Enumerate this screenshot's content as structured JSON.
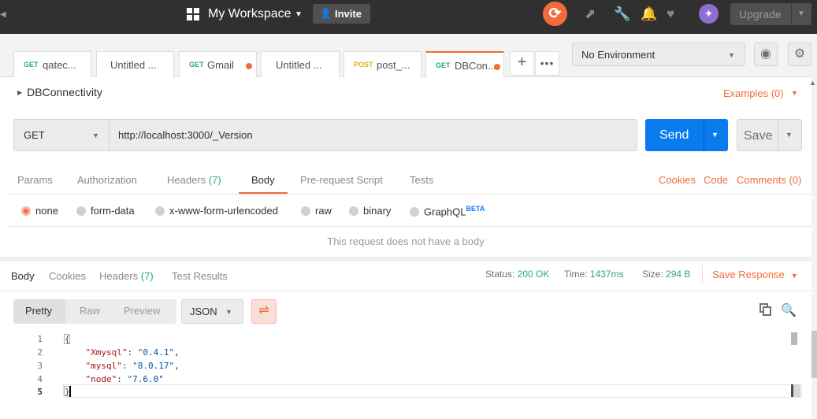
{
  "topbar": {
    "workspace_label": "My Workspace",
    "invite_label": "Invite",
    "upgrade_label": "Upgrade"
  },
  "tabs": [
    {
      "method": "GET",
      "name": "qatec...",
      "dot": false
    },
    {
      "method": "",
      "name": "Untitled ...",
      "dot": false
    },
    {
      "method": "GET",
      "name": "Gmail",
      "dot": true
    },
    {
      "method": "",
      "name": "Untitled ...",
      "dot": false
    },
    {
      "method": "POST",
      "name": "post_...",
      "dot": false
    },
    {
      "method": "GET",
      "name": "DBCon...",
      "dot": true
    }
  ],
  "environment": {
    "selected": "No Environment"
  },
  "request": {
    "name": "DBConnectivity",
    "examples_label": "Examples (0)",
    "method": "GET",
    "url": "http://localhost:3000/_Version",
    "send_label": "Send",
    "save_label": "Save"
  },
  "request_tabs": {
    "params": "Params",
    "authorization": "Authorization",
    "headers": "Headers",
    "headers_count": "(7)",
    "body": "Body",
    "prerequest": "Pre-request Script",
    "tests": "Tests",
    "cookies": "Cookies",
    "code": "Code",
    "comments": "Comments (0)"
  },
  "body_options": {
    "none": "none",
    "form_data": "form-data",
    "urlencoded": "x-www-form-urlencoded",
    "raw": "raw",
    "binary": "binary",
    "graphql": "GraphQL",
    "beta": "BETA",
    "empty_message": "This request does not have a body"
  },
  "response": {
    "tabs": {
      "body": "Body",
      "cookies": "Cookies",
      "headers": "Headers",
      "headers_count": "(7)",
      "test_results": "Test Results"
    },
    "status_label": "Status:",
    "status_value": "200 OK",
    "time_label": "Time:",
    "time_value": "1437ms",
    "size_label": "Size:",
    "size_value": "294 B",
    "save_response_label": "Save Response",
    "format": {
      "pretty": "Pretty",
      "raw": "Raw",
      "preview": "Preview",
      "language": "JSON"
    },
    "line_numbers": [
      "1",
      "2",
      "3",
      "4",
      "5"
    ],
    "code": {
      "open": "{",
      "key1": "\"Xmysql\"",
      "val1": "\"0.4.1\"",
      "key2": "\"mysql\"",
      "val2": "\"8.0.17\"",
      "key3": "\"node\"",
      "val3": "\"7.6.0\"",
      "close": "}"
    }
  }
}
